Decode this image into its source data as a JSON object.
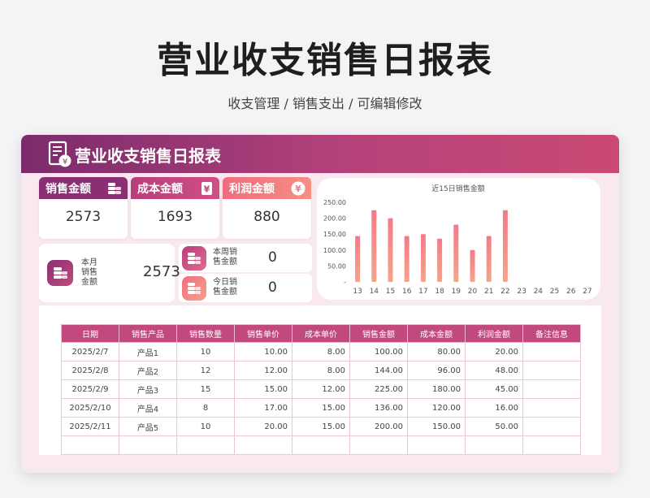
{
  "title": "营业收支销售日报表",
  "subtitle": "收支管理 / 销售支出 /  可编辑修改",
  "panel": {
    "title": "营业收支销售日报表"
  },
  "kpis": [
    {
      "label": "销售金额",
      "value": "2573",
      "color": "#8a2f73",
      "icon": "coins-icon"
    },
    {
      "label": "成本金额",
      "value": "1693",
      "color": "#c4457e",
      "icon": "yen-note-icon"
    },
    {
      "label": "利润金额",
      "value": "880",
      "color": "#f08282",
      "icon": "yen-coin-icon"
    }
  ],
  "month": {
    "label_1": "本月",
    "label_2": "销售",
    "label_3": "金额",
    "value": "2573"
  },
  "week": {
    "label_1": "本周销",
    "label_2": "售金额",
    "value": "0"
  },
  "today": {
    "label_1": "今日销",
    "label_2": "售金额",
    "value": "0"
  },
  "chart_data": {
    "type": "bar",
    "title": "近15日销售金额",
    "categories": [
      "13",
      "14",
      "15",
      "16",
      "17",
      "18",
      "19",
      "20",
      "21",
      "22",
      "23",
      "24",
      "25",
      "26",
      "27"
    ],
    "values": [
      144,
      225,
      200,
      144,
      150,
      136,
      180,
      100,
      144,
      225,
      0,
      0,
      0,
      0,
      0
    ],
    "ylim": [
      0,
      250
    ],
    "yticks": [
      "-",
      "50.00",
      "100.00",
      "150.00",
      "200.00",
      "250.00"
    ],
    "grid": false,
    "bar_color_top": "#f47a8a",
    "bar_color_bottom": "#f5a488"
  },
  "table": {
    "headers": [
      "日期",
      "销售产品",
      "销售数量",
      "销售单价",
      "成本单价",
      "销售金额",
      "成本金额",
      "利润金额",
      "备注信息"
    ],
    "rows": [
      [
        "2025/2/7",
        "产品1",
        "10",
        "10.00",
        "8.00",
        "100.00",
        "80.00",
        "20.00",
        ""
      ],
      [
        "2025/2/8",
        "产品2",
        "12",
        "12.00",
        "8.00",
        "144.00",
        "96.00",
        "48.00",
        ""
      ],
      [
        "2025/2/9",
        "产品3",
        "15",
        "15.00",
        "12.00",
        "225.00",
        "180.00",
        "45.00",
        ""
      ],
      [
        "2025/2/10",
        "产品4",
        "8",
        "17.00",
        "15.00",
        "136.00",
        "120.00",
        "16.00",
        ""
      ],
      [
        "2025/2/11",
        "产品5",
        "10",
        "20.00",
        "15.00",
        "200.00",
        "150.00",
        "50.00",
        ""
      ]
    ]
  }
}
